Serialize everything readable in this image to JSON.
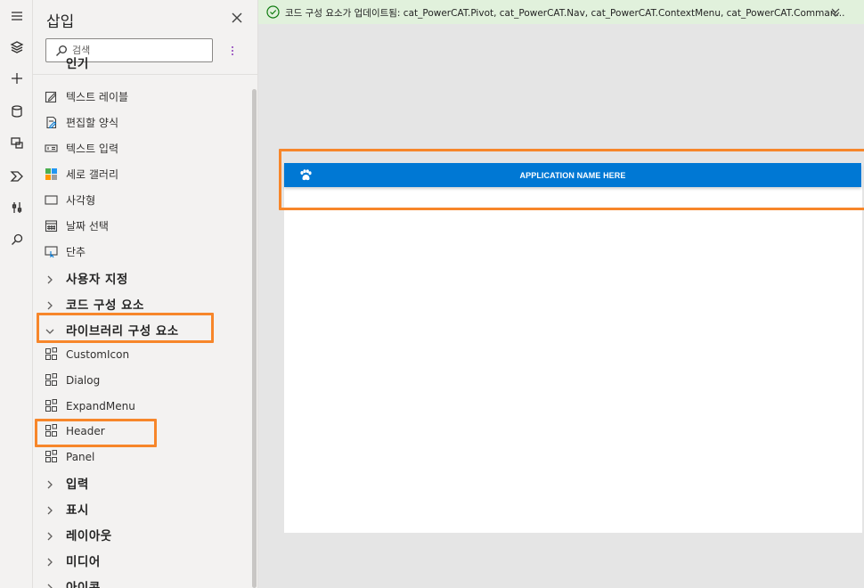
{
  "rail": {
    "items": [
      {
        "icon": "hamburger-menu-icon"
      },
      {
        "icon": "layers-icon"
      },
      {
        "icon": "plus-icon"
      },
      {
        "icon": "database-icon"
      },
      {
        "icon": "media-icon"
      },
      {
        "icon": "power-automate-icon"
      },
      {
        "icon": "tools-icon"
      },
      {
        "icon": "search-icon"
      }
    ]
  },
  "panel": {
    "title": "삽입",
    "search_placeholder": "검색",
    "partial_header": "인기",
    "items": [
      {
        "label": "텍스트 레이블",
        "icon": "text-label-icon"
      },
      {
        "label": "편집할 양식",
        "icon": "edit-form-icon"
      },
      {
        "label": "텍스트 입력",
        "icon": "text-input-icon"
      },
      {
        "label": "세로 갤러리",
        "icon": "vertical-gallery-icon"
      },
      {
        "label": "사각형",
        "icon": "rectangle-icon"
      },
      {
        "label": "날짜 선택",
        "icon": "date-picker-icon"
      },
      {
        "label": "단추",
        "icon": "button-icon"
      }
    ],
    "categories_top": [
      {
        "label": "사용자 지정"
      },
      {
        "label": "코드 구성 요소"
      }
    ],
    "library_category": {
      "label": "라이브러리 구성 요소"
    },
    "library_items": [
      {
        "label": "CustomIcon"
      },
      {
        "label": "Dialog"
      },
      {
        "label": "ExpandMenu"
      },
      {
        "label": "Header"
      },
      {
        "label": "Panel"
      }
    ],
    "categories_bottom": [
      {
        "label": "입력"
      },
      {
        "label": "표시"
      },
      {
        "label": "레이아웃"
      },
      {
        "label": "미디어"
      },
      {
        "label": "아이콘"
      }
    ]
  },
  "notification": {
    "message": "코드 구성 요소가 업데이트됨: cat_PowerCAT.Pivot, cat_PowerCAT.Nav, cat_PowerCAT.ContextMenu, cat_PowerCAT.Comman..."
  },
  "canvas": {
    "header_title": "APPLICATION NAME HERE"
  },
  "colors": {
    "accent_highlight": "#f7862a",
    "header_blue": "#0078d4",
    "notification_bg": "#e1f1dc"
  }
}
